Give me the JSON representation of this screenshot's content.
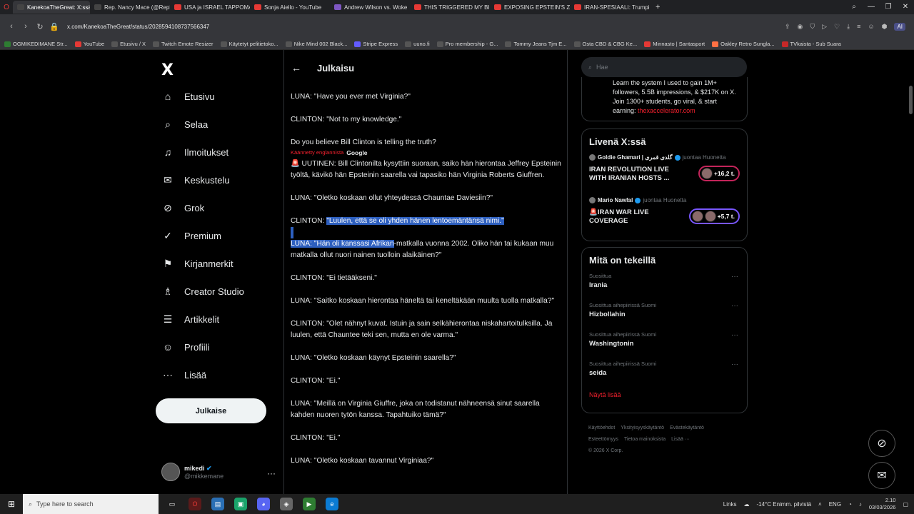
{
  "browser": {
    "tabs": [
      {
        "label": "KanekoaTheGreat: X:ssä: ",
        "color": "#444",
        "active": true
      },
      {
        "label": "Rep. Nancy Mace (@RepN",
        "color": "#444"
      },
      {
        "label": "USA ja ISRAEL TAPPOMA",
        "color": "#e53935"
      },
      {
        "label": "Sonja Aiello - YouTube",
        "color": "#e53935"
      },
      {
        "label": "Andrew Wilson vs. Woke",
        "color": "#7e57c2"
      },
      {
        "label": "THIS TRIGGERED MY BIGG",
        "color": "#e53935"
      },
      {
        "label": "EXPOSING EPSTEIN'S ZOR",
        "color": "#e53935"
      },
      {
        "label": "IRAN-SPESIAALI: Trumpin",
        "color": "#e53935"
      }
    ],
    "new_tab": "+",
    "url": "x.com/KanekoaTheGreat/status/2028594108737566347",
    "ai_label": "AI",
    "bookmarks": [
      {
        "label": "OGMIKEDIMANE Str...",
        "color": "#2e7d32"
      },
      {
        "label": "YouTube",
        "color": "#e53935"
      },
      {
        "label": "Etusivu / X",
        "color": "#555"
      },
      {
        "label": "Twitch Emote Resizer",
        "color": "#555"
      },
      {
        "label": "Käytetyt pelitietoko...",
        "color": "#555"
      },
      {
        "label": "Nike Mind 002 Black...",
        "color": "#555"
      },
      {
        "label": "Stripe Express",
        "color": "#635bff"
      },
      {
        "label": "uuno.fi",
        "color": "#555"
      },
      {
        "label": "Pro membership - G...",
        "color": "#555"
      },
      {
        "label": "Tommy Jeans Tjm E...",
        "color": "#555"
      },
      {
        "label": "Osta CBD & CBG Ke...",
        "color": "#555"
      },
      {
        "label": "Minnasto | Santasport",
        "color": "#e53935"
      },
      {
        "label": "Oakley Retro Sungla...",
        "color": "#ff7043"
      },
      {
        "label": "TVkaista - Sub Suara",
        "color": "#c62828"
      }
    ]
  },
  "nav": {
    "logo": "X",
    "items": [
      {
        "label": "Etusivu",
        "icon": "home-icon",
        "glyph": "⌂"
      },
      {
        "label": "Selaa",
        "icon": "search-icon",
        "glyph": "⌕"
      },
      {
        "label": "Ilmoitukset",
        "icon": "bell-icon",
        "glyph": "♫"
      },
      {
        "label": "Keskustelu",
        "icon": "mail-icon",
        "glyph": "✉"
      },
      {
        "label": "Grok",
        "icon": "grok-icon",
        "glyph": "⊘"
      },
      {
        "label": "Premium",
        "icon": "verified-icon",
        "glyph": "✓"
      },
      {
        "label": "Kirjanmerkit",
        "icon": "bookmark-icon",
        "glyph": "⚑"
      },
      {
        "label": "Creator Studio",
        "icon": "creator-icon",
        "glyph": "♗"
      },
      {
        "label": "Artikkelit",
        "icon": "article-icon",
        "glyph": "☰"
      },
      {
        "label": "Profiili",
        "icon": "profile-icon",
        "glyph": "☺"
      },
      {
        "label": "Lisää",
        "icon": "more-icon",
        "glyph": "⋯"
      }
    ],
    "post_button": "Julkaise",
    "account": {
      "name": "mikedi",
      "handle": "@mikkemane",
      "more": "···"
    }
  },
  "main": {
    "back": "←",
    "title": "Julkaisu",
    "lines": [
      "LUNA: \"Have you ever met Virginia?\"",
      "CLINTON: \"Not to my knowledge.\"",
      "Do you believe Bill Clinton is telling the truth?"
    ],
    "translated_label": "Käännetty englannista",
    "translated_by": "Google",
    "translation_intro": "🚨 UUTINEN: Bill Clintonilta kysyttiin suoraan, saiko hän hierontaa Jeffrey Epsteinin työltä, kävikö hän Epsteinin saarella vai tapasiko hän Virginia Roberts Giuffren.",
    "q1": "LUNA: \"Oletko koskaan ollut yhteydessä Chauntae Daviesiin?\"",
    "a1_prefix": "CLINTON: ",
    "a1_highlight": "\"Luulen, että se oli yhden hänen lentoemäntänsä nimi.\"",
    "q2_highlight": "LUNA: \"Hän oli kanssasi Afrikan",
    "q2_rest": "-matkalla vuonna 2002. Oliko hän tai kukaan muu matkalla ollut nuori nainen tuolloin alaikäinen?\"",
    "rest": [
      "CLINTON: \"Ei tietääkseni.\"",
      "LUNA: \"Saitko koskaan hierontaa häneltä tai keneltäkään muulta tuolla matkalla?\"",
      "CLINTON: \"Olet nähnyt kuvat. Istuin ja sain selkähierontaa niskahartoitulksilla. Ja luulen, että Chauntee teki sen, mutta en ole varma.\"",
      "LUNA: \"Oletko koskaan käynyt Epsteinin saarella?\"",
      "CLINTON: \"Ei.\"",
      "LUNA: \"Meillä on Virginia Giuffre, joka on todistanut nähneensä sinut saarella kahden nuoren tytön kanssa. Tapahtuiko tämä?\"",
      "CLINTON: \"Ei.\"",
      "LUNA: \"Oletko koskaan tavannut Virginiaa?\""
    ]
  },
  "right": {
    "search_placeholder": "Hae",
    "promo_text": "Learn the system I used to gain 1M+ followers, 5.5B impressions, & $217K on X. Join 1300+ students, go viral, & start earning: ",
    "promo_link": "thexaccelerator.com",
    "live_title": "Livenä X:ssä",
    "live": [
      {
        "host": "Goldie Ghamari | گلدی قمری",
        "sub": "juontaa Huonetta",
        "title": "IRAN REVOLUTION LIVE WITH IRANIAN HOSTS ...",
        "count": "+16,2 t.",
        "accent": "#c3245a"
      },
      {
        "host": "Mario Nawfal",
        "sub": "juontaa Huonetta",
        "title": "🚨IRAN WAR LIVE COVERAGE",
        "count": "+5,7 t.",
        "accent": "#7856ff"
      }
    ],
    "trends_title": "Mitä on tekeillä",
    "trends": [
      {
        "context": "Suosittua",
        "name": "Irania"
      },
      {
        "context": "Suosittua aihepiirissä Suomi",
        "name": "Hizbollahin"
      },
      {
        "context": "Suosittua aihepiirissä Suomi",
        "name": "Washingtonin"
      },
      {
        "context": "Suosittua aihepiirissä Suomi",
        "name": "seida"
      }
    ],
    "show_more": "Näytä lisää",
    "footer_row1": [
      "Käyttöehdot",
      "Yksityisyyskäytäntö",
      "Evästekäytäntö"
    ],
    "footer_row2": [
      "Esteettömyys",
      "Tietoa mainoksista",
      "Lisää ···"
    ],
    "copyright": "© 2026 X Corp."
  },
  "taskbar": {
    "search_placeholder": "Type here to search",
    "links": "Links",
    "weather": "-14°C  Enimm. pilvistä",
    "lang": "ENG",
    "time": "2.10",
    "date": "03/03/2026"
  }
}
